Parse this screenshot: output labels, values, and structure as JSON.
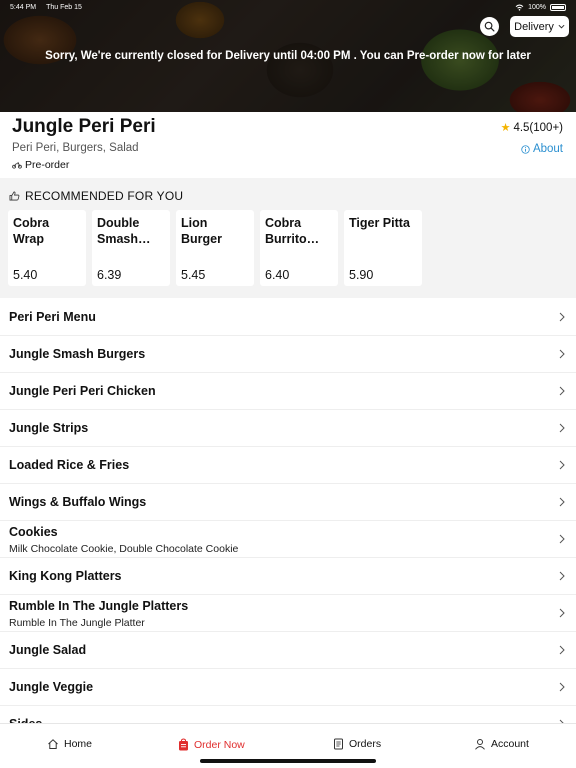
{
  "status_bar": {
    "time": "5:44 PM",
    "date": "Thu Feb 15",
    "battery": "100%"
  },
  "hero": {
    "message": "Sorry, We're currently closed for Delivery until 04:00 PM . You can Pre-order now for later",
    "delivery_label": "Delivery"
  },
  "restaurant": {
    "name": "Jungle Peri Peri",
    "tags": "Peri Peri, Burgers, Salad",
    "preorder": "Pre-order",
    "rating": "4.5(100+)",
    "about": "About"
  },
  "recommended": {
    "title": "RECOMMENDED FOR YOU",
    "items": [
      {
        "name": "Cobra Wrap",
        "price": "5.40"
      },
      {
        "name": "Double Smash Burger",
        "price": "6.39"
      },
      {
        "name": "Lion Burger",
        "price": "5.45"
      },
      {
        "name": "Cobra Burrito Bowl",
        "price": "6.40"
      },
      {
        "name": "Tiger Pitta",
        "price": "5.90"
      }
    ]
  },
  "menu": [
    {
      "title": "Peri Peri Menu",
      "sub": ""
    },
    {
      "title": "Jungle Smash Burgers",
      "sub": ""
    },
    {
      "title": "Jungle Peri Peri Chicken",
      "sub": ""
    },
    {
      "title": "Jungle Strips",
      "sub": ""
    },
    {
      "title": "Loaded Rice & Fries",
      "sub": ""
    },
    {
      "title": "Wings & Buffalo Wings",
      "sub": ""
    },
    {
      "title": "Cookies",
      "sub": "Milk Chocolate Cookie, Double Chocolate Cookie"
    },
    {
      "title": "King Kong Platters",
      "sub": ""
    },
    {
      "title": "Rumble In The Jungle Platters",
      "sub": "Rumble In The Jungle Platter"
    },
    {
      "title": "Jungle Salad",
      "sub": ""
    },
    {
      "title": "Jungle Veggie",
      "sub": ""
    },
    {
      "title": "Sides",
      "sub": ""
    }
  ],
  "nav": {
    "home": "Home",
    "order_now": "Order Now",
    "orders": "Orders",
    "account": "Account"
  },
  "colors": {
    "accent": "#e02e2e",
    "link": "#2a8fd0",
    "star": "#f4b400"
  }
}
